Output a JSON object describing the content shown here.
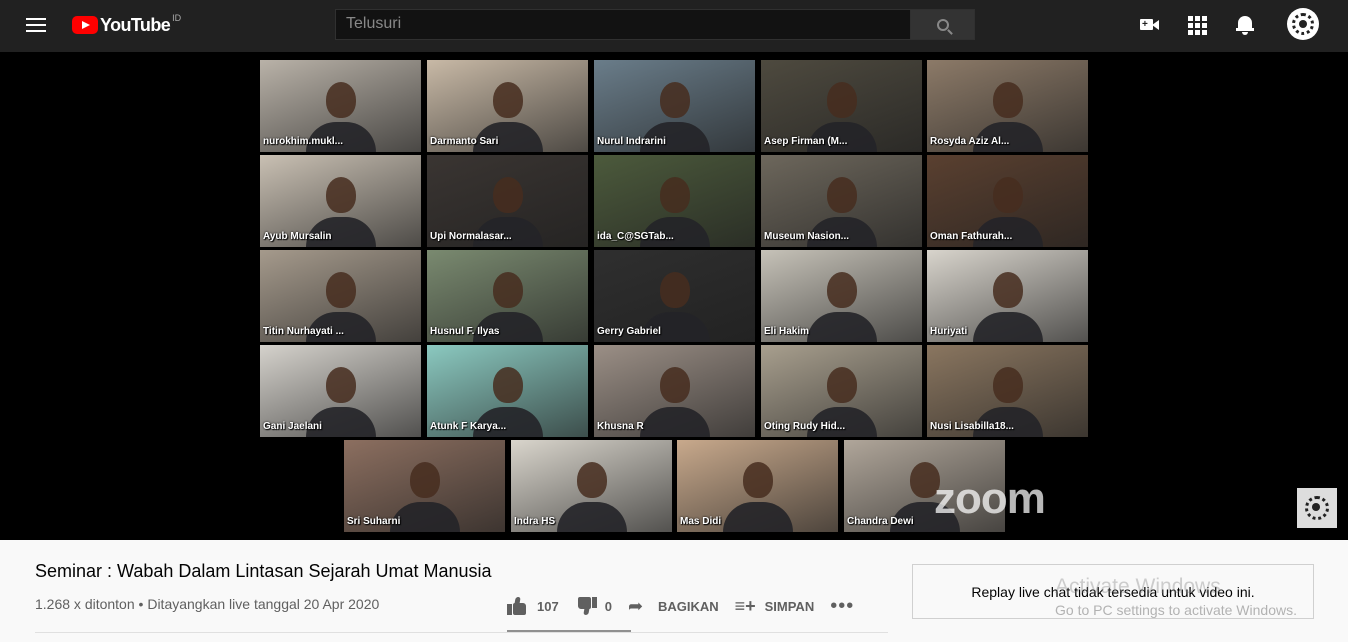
{
  "header": {
    "logo_text": "YouTube",
    "country_code": "ID",
    "search_placeholder": "Telusuri"
  },
  "video": {
    "participants": [
      "nurokhim.mukl...",
      "Darmanto Sari",
      "Nurul Indrarini",
      "Asep Firman (M...",
      "Rosyda Aziz Al...",
      "Ayub Mursalin",
      "Upi Normalasar...",
      "ida_C@SGTab...",
      "Museum Nasion...",
      "Oman Fathurah...",
      "Titin Nurhayati ...",
      "Husnul F. Ilyas",
      "Gerry Gabriel",
      "Eli Hakim",
      "Huriyati",
      "Gani Jaelani",
      "Atunk F Karya...",
      "Khusna R",
      "Oting Rudy Hid...",
      "Nusi Lisabilla18...",
      "Sri Suharni",
      "Indra HS",
      "Mas Didi",
      "Chandra Dewi"
    ],
    "active_speaker_color": "#7ed321",
    "watermark": "zoom"
  },
  "info": {
    "title": "Seminar : Wabah Dalam Lintasan Sejarah Umat Manusia",
    "views": "1.268 x ditonton",
    "separator": "•",
    "date": "Ditayangkan live tanggal 20 Apr 2020",
    "likes": "107",
    "dislikes": "0",
    "share_label": "BAGIKAN",
    "save_label": "SIMPAN",
    "more_label": "•••"
  },
  "chat": {
    "message": "Replay live chat tidak tersedia untuk video ini."
  },
  "windows_watermark": {
    "line1": "Activate Windows",
    "line2": "Go to PC settings to activate Windows."
  }
}
